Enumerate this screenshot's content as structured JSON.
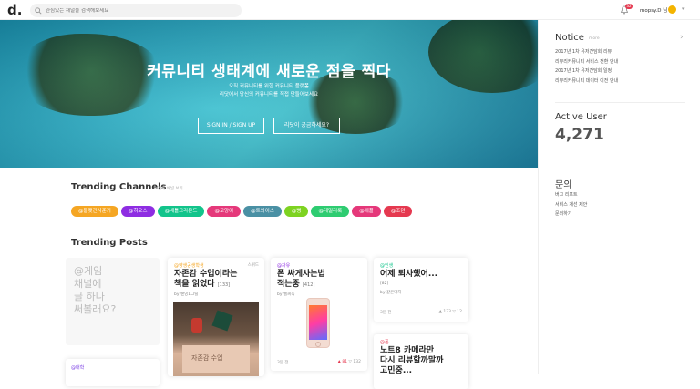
{
  "topbar": {
    "search_placeholder": "관심있는 채널을 검색해보세요",
    "notification_count": "32",
    "username": "mopsy.D 님"
  },
  "hero": {
    "headline": "커뮤니티 생태계에 새로운 점을 찍다",
    "sub_line1": "오직 커뮤니티를 위한 커뮤니티 플랫폼",
    "sub_line2": "리닷에서 당신의 커뮤니티를 직접 만들어보세요",
    "signin_label": "SIGN IN / SIGN UP",
    "curious_label": "리닷이 궁금하세요?"
  },
  "sidebar": {
    "notice_title": "Notice",
    "notice_more": "more",
    "notices": [
      "2017년 1차 유저간담회 리뷰",
      "리뷰리커뮤니티 서비스 전환 안내",
      "2017년 1차 유저간담회 일정",
      "리뷰리커뮤니티 데이터 이전 안내"
    ],
    "active_user_title": "Active User",
    "active_user_count": "4,271",
    "inquiry_title": "문의",
    "inquiries": [
      "버그 리포트",
      "서비스 개선 제안",
      "문의하기"
    ]
  },
  "trending_channels": {
    "title": "Trending Channels",
    "more": "전체 채널 보기",
    "chips": [
      {
        "label": "@블랫긴사준기",
        "color": "#f5a623"
      },
      {
        "label": "@히오스",
        "color": "#8e2de2"
      },
      {
        "label": "@배틀그라운드",
        "color": "#12c48b"
      },
      {
        "label": "@고양이",
        "color": "#e5387a"
      },
      {
        "label": "@트와이스",
        "color": "#4a90a4"
      },
      {
        "label": "@뻥",
        "color": "#7ed321"
      },
      {
        "label": "@데일리룩",
        "color": "#2ecc71"
      },
      {
        "label": "@애플",
        "color": "#e5387a"
      },
      {
        "label": "@조던",
        "color": "#e53950"
      }
    ]
  },
  "trending_posts": {
    "title": "Trending Posts",
    "placeholder": "@게임\n채널에\n글 하나\n써볼래요?",
    "bottom_tag": "@대학",
    "posts": [
      {
        "tag": "@향생공생학생",
        "tag_color": "#f5a623",
        "side": "스위드",
        "title": "자존감 수업이라는\n책을 읽었다",
        "count": "[133]",
        "by": "by 쌘밍1그릴",
        "photo_text": "자존감 수업"
      },
      {
        "tag": "@자유",
        "tag_color": "#8e2de2",
        "title": "폰 싸게사는법\n적는중",
        "count": "[412]",
        "by": "by 헬씨녹",
        "time": "3분 전",
        "up": "▲ 81",
        "down": "▽ 132"
      },
      {
        "tag": "@인생",
        "tag_color": "#12c48b",
        "title": "어제 퇴사했어...",
        "count": "[82]",
        "by": "by 같은마지",
        "time": "3분 전",
        "up": "▲ 133",
        "down": "▽ 12"
      },
      {
        "tag": "@폰",
        "tag_color": "#e53950",
        "title": "노트8 카메라만\n다시 리뷰할까말까\n고민중..."
      }
    ]
  }
}
